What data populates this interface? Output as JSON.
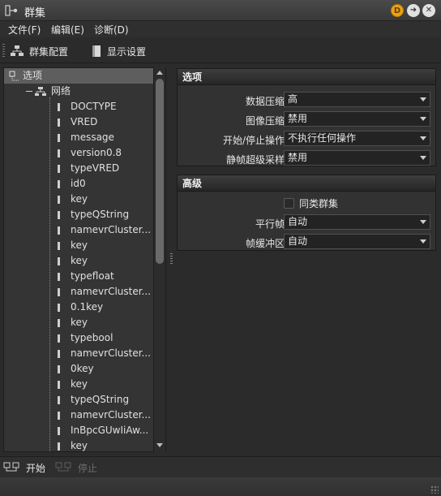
{
  "window": {
    "title": "群集"
  },
  "titlebar_buttons": {
    "d_label": "D"
  },
  "menu": {
    "items": [
      "文件(F)",
      "编辑(E)",
      "诊断(D)"
    ]
  },
  "toolbar": {
    "cluster_config": "群集配置",
    "display_settings": "显示设置"
  },
  "tree": {
    "root": "选项",
    "network": "网络",
    "items": [
      "DOCTYPE",
      "VRED",
      "message",
      "version0.8",
      "typeVRED",
      "id0",
      "key",
      "typeQString",
      "namevrCluster...",
      "key",
      "key",
      "typefloat",
      "namevrCluster...",
      "0.1key",
      "key",
      "typebool",
      "namevrCluster...",
      "0key",
      "key",
      "typeQString",
      "namevrCluster...",
      "InBpcGUwIiAw...",
      "key"
    ]
  },
  "options_group": {
    "title": "选项",
    "rows": [
      {
        "label": "数据压缩",
        "value": "高"
      },
      {
        "label": "图像压缩",
        "value": "禁用"
      },
      {
        "label": "开始/停止操作",
        "value": "不执行任何操作"
      },
      {
        "label": "静帧超级采样",
        "value": "禁用"
      }
    ]
  },
  "advanced_group": {
    "title": "高级",
    "checkbox_label": "同类群集",
    "rows": [
      {
        "label": "平行帧",
        "value": "自动"
      },
      {
        "label": "帧缓冲区",
        "value": "自动"
      }
    ]
  },
  "status": {
    "start": "开始",
    "stop": "停止"
  }
}
